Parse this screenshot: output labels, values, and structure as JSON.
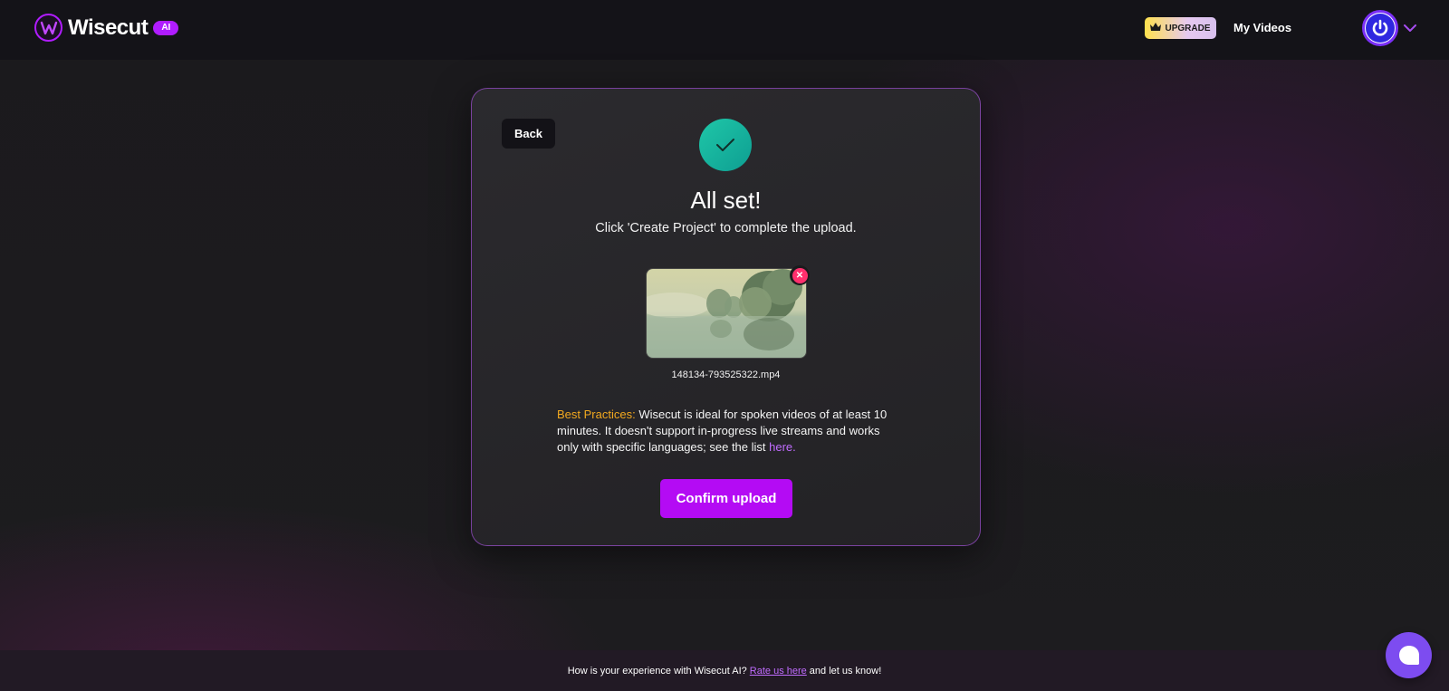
{
  "header": {
    "brand": "Wisecut",
    "ai_badge": "AI",
    "upgrade_label": "UPGRADE",
    "my_videos_label": "My Videos"
  },
  "card": {
    "back_label": "Back",
    "title": "All set!",
    "subtitle": "Click 'Create Project' to complete the upload.",
    "filename": "148134-793525322.mp4",
    "practices_label": "Best Practices:",
    "practices_text": " Wisecut is ideal for spoken videos of at least 10 minutes. It doesn't support in-progress live streams and works only with specific languages; see the list ",
    "practices_link": "here.",
    "confirm_label": "Confirm upload"
  },
  "footer": {
    "text_before": "How is your experience with Wisecut AI?",
    "rate_link": "Rate us here",
    "text_after": "and let us know!"
  },
  "colors": {
    "accent": "#b40bf4",
    "success": "#16b49f",
    "upgrade_start": "#ffe14d",
    "link": "#c06cff",
    "practices_label": "#f2a91f",
    "remove": "#ff2f6d",
    "chat": "#7d4cf0"
  },
  "icons": {
    "logo": "wisecut-logo-icon",
    "crown": "crown-icon",
    "avatar": "power-icon",
    "chevron": "chevron-down-icon",
    "check": "check-icon",
    "remove": "close-icon",
    "chat": "chat-bubble-icon"
  }
}
